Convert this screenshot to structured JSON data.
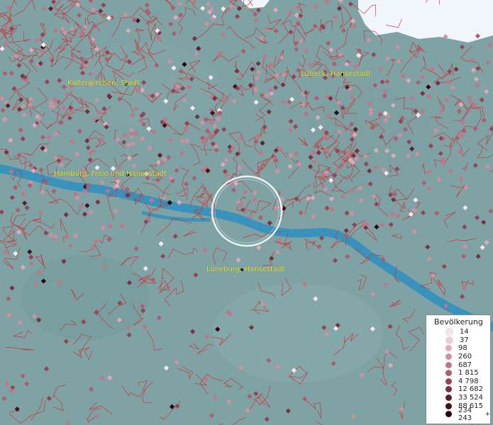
{
  "map": {
    "cities": [
      {
        "name": "Kaltenkirchen, Stadt"
      },
      {
        "name": "Lübeck, Hansestadt"
      },
      {
        "name": "Hamburg, Freie und Hansestadt"
      },
      {
        "name": "Lüneburg, Hansestadt"
      }
    ],
    "colors": {
      "land": "#7fa3a5",
      "water": "#2b8fc0",
      "boundary": "#d42a2a",
      "label": "#e8e82a",
      "sea": "#f0f6fb"
    }
  },
  "legend": {
    "title": "Bevölkerung",
    "plus_mark": "+",
    "items": [
      {
        "label": "14",
        "color": "#f7e6ec"
      },
      {
        "label": "37",
        "color": "#eecdd6"
      },
      {
        "label": "98",
        "color": "#e0aab8"
      },
      {
        "label": "260",
        "color": "#d290a0"
      },
      {
        "label": "687",
        "color": "#c07686"
      },
      {
        "label": "1 815",
        "color": "#ae5d6e"
      },
      {
        "label": "4 798",
        "color": "#944456"
      },
      {
        "label": "12 682",
        "color": "#7a3040"
      },
      {
        "label": "33 524",
        "color": "#5e1f2c"
      },
      {
        "label": "88 615",
        "color": "#43111c"
      },
      {
        "label": "234 243",
        "color": "#260710"
      }
    ]
  }
}
